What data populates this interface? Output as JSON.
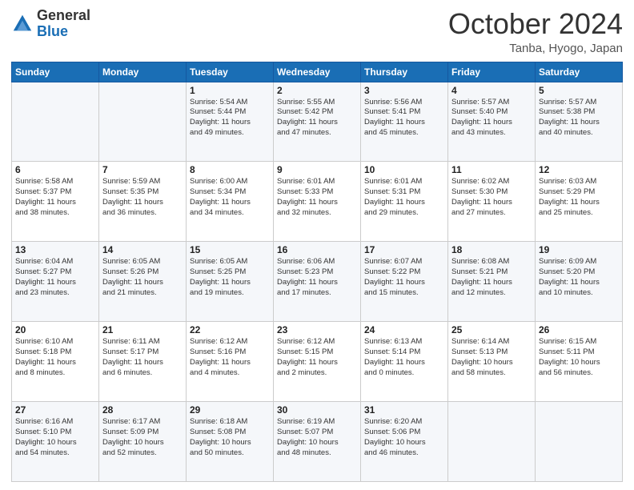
{
  "logo": {
    "line1": "General",
    "line2": "Blue"
  },
  "header": {
    "month": "October 2024",
    "location": "Tanba, Hyogo, Japan"
  },
  "weekdays": [
    "Sunday",
    "Monday",
    "Tuesday",
    "Wednesday",
    "Thursday",
    "Friday",
    "Saturday"
  ],
  "weeks": [
    [
      {
        "day": "",
        "info": ""
      },
      {
        "day": "",
        "info": ""
      },
      {
        "day": "1",
        "info": "Sunrise: 5:54 AM\nSunset: 5:44 PM\nDaylight: 11 hours\nand 49 minutes."
      },
      {
        "day": "2",
        "info": "Sunrise: 5:55 AM\nSunset: 5:42 PM\nDaylight: 11 hours\nand 47 minutes."
      },
      {
        "day": "3",
        "info": "Sunrise: 5:56 AM\nSunset: 5:41 PM\nDaylight: 11 hours\nand 45 minutes."
      },
      {
        "day": "4",
        "info": "Sunrise: 5:57 AM\nSunset: 5:40 PM\nDaylight: 11 hours\nand 43 minutes."
      },
      {
        "day": "5",
        "info": "Sunrise: 5:57 AM\nSunset: 5:38 PM\nDaylight: 11 hours\nand 40 minutes."
      }
    ],
    [
      {
        "day": "6",
        "info": "Sunrise: 5:58 AM\nSunset: 5:37 PM\nDaylight: 11 hours\nand 38 minutes."
      },
      {
        "day": "7",
        "info": "Sunrise: 5:59 AM\nSunset: 5:35 PM\nDaylight: 11 hours\nand 36 minutes."
      },
      {
        "day": "8",
        "info": "Sunrise: 6:00 AM\nSunset: 5:34 PM\nDaylight: 11 hours\nand 34 minutes."
      },
      {
        "day": "9",
        "info": "Sunrise: 6:01 AM\nSunset: 5:33 PM\nDaylight: 11 hours\nand 32 minutes."
      },
      {
        "day": "10",
        "info": "Sunrise: 6:01 AM\nSunset: 5:31 PM\nDaylight: 11 hours\nand 29 minutes."
      },
      {
        "day": "11",
        "info": "Sunrise: 6:02 AM\nSunset: 5:30 PM\nDaylight: 11 hours\nand 27 minutes."
      },
      {
        "day": "12",
        "info": "Sunrise: 6:03 AM\nSunset: 5:29 PM\nDaylight: 11 hours\nand 25 minutes."
      }
    ],
    [
      {
        "day": "13",
        "info": "Sunrise: 6:04 AM\nSunset: 5:27 PM\nDaylight: 11 hours\nand 23 minutes."
      },
      {
        "day": "14",
        "info": "Sunrise: 6:05 AM\nSunset: 5:26 PM\nDaylight: 11 hours\nand 21 minutes."
      },
      {
        "day": "15",
        "info": "Sunrise: 6:05 AM\nSunset: 5:25 PM\nDaylight: 11 hours\nand 19 minutes."
      },
      {
        "day": "16",
        "info": "Sunrise: 6:06 AM\nSunset: 5:23 PM\nDaylight: 11 hours\nand 17 minutes."
      },
      {
        "day": "17",
        "info": "Sunrise: 6:07 AM\nSunset: 5:22 PM\nDaylight: 11 hours\nand 15 minutes."
      },
      {
        "day": "18",
        "info": "Sunrise: 6:08 AM\nSunset: 5:21 PM\nDaylight: 11 hours\nand 12 minutes."
      },
      {
        "day": "19",
        "info": "Sunrise: 6:09 AM\nSunset: 5:20 PM\nDaylight: 11 hours\nand 10 minutes."
      }
    ],
    [
      {
        "day": "20",
        "info": "Sunrise: 6:10 AM\nSunset: 5:18 PM\nDaylight: 11 hours\nand 8 minutes."
      },
      {
        "day": "21",
        "info": "Sunrise: 6:11 AM\nSunset: 5:17 PM\nDaylight: 11 hours\nand 6 minutes."
      },
      {
        "day": "22",
        "info": "Sunrise: 6:12 AM\nSunset: 5:16 PM\nDaylight: 11 hours\nand 4 minutes."
      },
      {
        "day": "23",
        "info": "Sunrise: 6:12 AM\nSunset: 5:15 PM\nDaylight: 11 hours\nand 2 minutes."
      },
      {
        "day": "24",
        "info": "Sunrise: 6:13 AM\nSunset: 5:14 PM\nDaylight: 11 hours\nand 0 minutes."
      },
      {
        "day": "25",
        "info": "Sunrise: 6:14 AM\nSunset: 5:13 PM\nDaylight: 10 hours\nand 58 minutes."
      },
      {
        "day": "26",
        "info": "Sunrise: 6:15 AM\nSunset: 5:11 PM\nDaylight: 10 hours\nand 56 minutes."
      }
    ],
    [
      {
        "day": "27",
        "info": "Sunrise: 6:16 AM\nSunset: 5:10 PM\nDaylight: 10 hours\nand 54 minutes."
      },
      {
        "day": "28",
        "info": "Sunrise: 6:17 AM\nSunset: 5:09 PM\nDaylight: 10 hours\nand 52 minutes."
      },
      {
        "day": "29",
        "info": "Sunrise: 6:18 AM\nSunset: 5:08 PM\nDaylight: 10 hours\nand 50 minutes."
      },
      {
        "day": "30",
        "info": "Sunrise: 6:19 AM\nSunset: 5:07 PM\nDaylight: 10 hours\nand 48 minutes."
      },
      {
        "day": "31",
        "info": "Sunrise: 6:20 AM\nSunset: 5:06 PM\nDaylight: 10 hours\nand 46 minutes."
      },
      {
        "day": "",
        "info": ""
      },
      {
        "day": "",
        "info": ""
      }
    ]
  ]
}
